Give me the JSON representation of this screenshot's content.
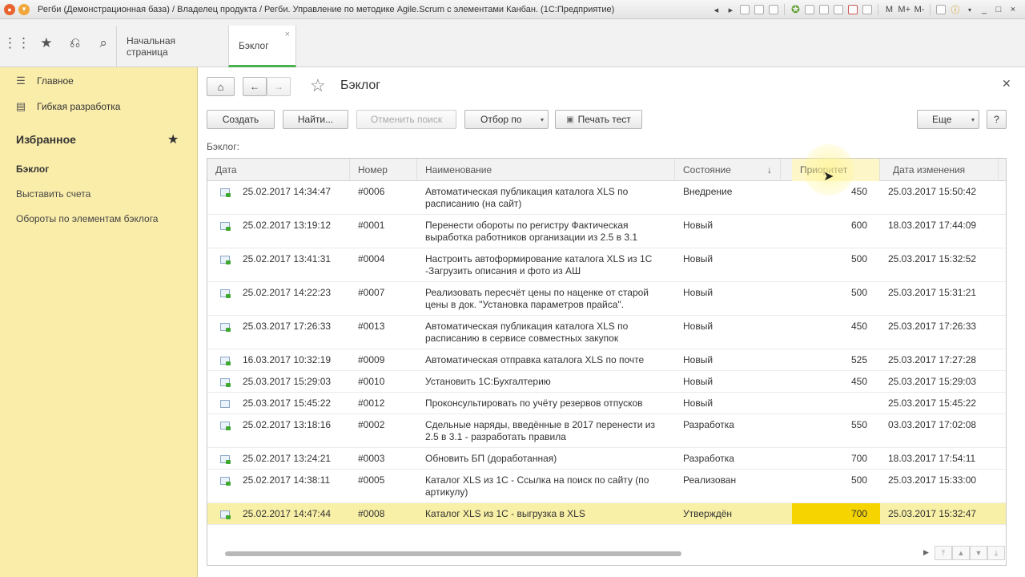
{
  "window": {
    "title": "Регби (Демонстрационная база) / Владелец продукта / Регби. Управление по методике Agile.Scrum с элементами Канбан.  (1С:Предприятие)",
    "controls": [
      "M",
      "M+",
      "M-",
      "i",
      "_",
      "□",
      "×"
    ]
  },
  "nav": {
    "tabs": [
      {
        "label": "Начальная страница"
      },
      {
        "label": "Бэклог",
        "close": "×"
      }
    ]
  },
  "sidebar": {
    "top_items": [
      {
        "label": "Главное",
        "icon": "menu-icon"
      },
      {
        "label": "Гибкая разработка",
        "icon": "book-icon"
      }
    ],
    "favorites_title": "Избранное",
    "links": [
      {
        "label": "Бэклог",
        "current": true
      },
      {
        "label": "Выставить счета"
      },
      {
        "label": "Обороты по элементам бэклога"
      }
    ]
  },
  "page": {
    "title": "Бэклог",
    "section_label": "Бэклог:"
  },
  "toolbar": {
    "create": "Создать",
    "find": "Найти...",
    "cancel_search": "Отменить поиск",
    "filter": "Отбор по",
    "print": "Печать тест",
    "more": "Еще",
    "help": "?"
  },
  "table": {
    "columns": [
      "Дата",
      "Номер",
      "Наименование",
      "Состояние",
      "Приоритет",
      "Дата изменения"
    ],
    "sort_indicator": "↓",
    "rows": [
      {
        "date": "25.02.2017 14:34:47",
        "num": "#0006",
        "name": "Автоматическая публикация каталога XLS по расписанию (на сайт)",
        "state": "Внедрение",
        "prio": "450",
        "changed": "25.03.2017 15:50:42",
        "lines": 2,
        "icon": "check"
      },
      {
        "date": "25.02.2017 13:19:12",
        "num": "#0001",
        "name": "Перенести обороты по регистру Фактическая выработка работников организации из 2.5 в 3.1",
        "state": "Новый",
        "prio": "600",
        "changed": "18.03.2017 17:44:09",
        "lines": 2,
        "icon": "check"
      },
      {
        "date": "25.02.2017 13:41:31",
        "num": "#0004",
        "name": "Настроить автоформирование каталога XLS из 1С -Загрузить описания и фото из АШ",
        "state": "Новый",
        "prio": "500",
        "changed": "25.03.2017 15:32:52",
        "lines": 2,
        "icon": "check"
      },
      {
        "date": "25.02.2017 14:22:23",
        "num": "#0007",
        "name": "Реализовать пересчёт цены по наценке от старой цены в док. \"Установка параметров прайса\".",
        "state": "Новый",
        "prio": "500",
        "changed": "25.03.2017 15:31:21",
        "lines": 2,
        "icon": "check"
      },
      {
        "date": "25.03.2017 17:26:33",
        "num": "#0013",
        "name": "Автоматическая публикация каталога XLS по расписанию в сервисе совместных закупок",
        "state": "Новый",
        "prio": "450",
        "changed": "25.03.2017 17:26:33",
        "lines": 2,
        "icon": "check"
      },
      {
        "date": "16.03.2017 10:32:19",
        "num": "#0009",
        "name": "Автоматическая отправка каталога XLS по почте",
        "state": "Новый",
        "prio": "525",
        "changed": "25.03.2017 17:27:28",
        "lines": 1,
        "icon": "check"
      },
      {
        "date": "25.03.2017 15:29:03",
        "num": "#0010",
        "name": "Установить 1С:Бухгалтерию",
        "state": "Новый",
        "prio": "450",
        "changed": "25.03.2017 15:29:03",
        "lines": 1,
        "icon": "check"
      },
      {
        "date": "25.03.2017 15:45:22",
        "num": "#0012",
        "name": "Проконсультировать по учёту резервов отпусков",
        "state": "Новый",
        "prio": "",
        "changed": "25.03.2017 15:45:22",
        "lines": 1,
        "icon": "plain"
      },
      {
        "date": "25.02.2017 13:18:16",
        "num": "#0002",
        "name": "Сдельные наряды, введённые в 2017 перенести из 2.5 в 3.1 - разработать правила",
        "state": "Разработка",
        "prio": "550",
        "changed": "03.03.2017 17:02:08",
        "lines": 2,
        "icon": "check"
      },
      {
        "date": "25.02.2017 13:24:21",
        "num": "#0003",
        "name": "Обновить БП (доработанная)",
        "state": "Разработка",
        "prio": "700",
        "changed": "18.03.2017 17:54:11",
        "lines": 1,
        "icon": "check"
      },
      {
        "date": "25.02.2017 14:38:11",
        "num": "#0005",
        "name": "Каталог XLS из 1С - Ссылка на поиск по сайту (по артикулу)",
        "state": "Реализован",
        "prio": "500",
        "changed": "25.03.2017 15:33:00",
        "lines": 2,
        "icon": "check"
      },
      {
        "date": "25.02.2017 14:47:44",
        "num": "#0008",
        "name": "Каталог XLS из 1С - выгрузка в XLS",
        "state": "Утверждён",
        "prio": "700",
        "changed": "25.03.2017 15:32:47",
        "lines": 1,
        "icon": "check",
        "selected": true
      }
    ]
  },
  "colors": {
    "sidebar_bg": "#faedaa",
    "selected_row": "#f9f0a7",
    "selected_cell": "#f5d400",
    "active_tab_underline": "#4caf50"
  }
}
